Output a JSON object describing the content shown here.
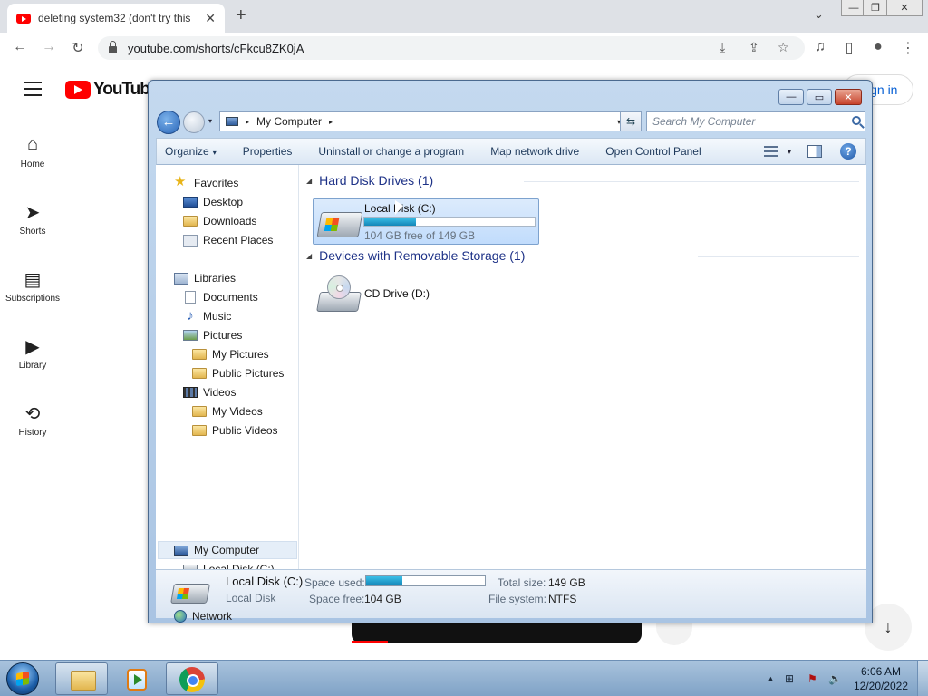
{
  "browser": {
    "tab_title": "deleting system32 (don't try this",
    "tab_close": "✕",
    "new_tab": "+",
    "tab_search": "⌄",
    "window_controls": [
      "—",
      "❐",
      "✕"
    ],
    "url": "youtube.com/shorts/cFkcu8ZK0jA",
    "nav_icons": {
      "back": "←",
      "forward": "→",
      "reload": "↻"
    },
    "omnibox_icons": {
      "install": "⤓",
      "share": "⇪",
      "bookmark": "☆"
    },
    "toolbar_icons": {
      "media": "♫",
      "sidepanel": "▯",
      "profile": "●",
      "menu": "⋮"
    }
  },
  "youtube": {
    "logo_text": "YouTube",
    "signin_label": "ign in",
    "nav": [
      {
        "icon": "⌂",
        "label": "Home"
      },
      {
        "icon": "➤",
        "label": "Shorts"
      },
      {
        "icon": "▤",
        "label": "Subscriptions"
      },
      {
        "icon": "▶",
        "label": "Library"
      },
      {
        "icon": "⟲",
        "label": "History"
      }
    ],
    "scroll_down_icon": "↓"
  },
  "explorer": {
    "window_buttons": {
      "minimize": "—",
      "maximize": "▭",
      "close": "✕"
    },
    "back_icon": "←",
    "address": {
      "path": "My Computer",
      "arrow": "▸",
      "dropdown": "▾"
    },
    "refresh_icon": "⇆",
    "search_placeholder": "Search My Computer",
    "commands": [
      {
        "label": "Organize",
        "dropdown": "▾"
      },
      {
        "label": "Properties"
      },
      {
        "label": "Uninstall or change a program"
      },
      {
        "label": "Map network drive"
      },
      {
        "label": "Open Control Panel"
      }
    ],
    "view_dropdown": "▾",
    "help_label": "?",
    "nav_items": [
      {
        "label": "Favorites",
        "icon": "star-icon",
        "glyph": "★"
      },
      {
        "label": "Desktop",
        "icon": "desktop-icon"
      },
      {
        "label": "Downloads",
        "icon": "folder-icon"
      },
      {
        "label": "Recent Places",
        "icon": "recent-places-icon"
      },
      {
        "label": "Libraries",
        "icon": "libraries-icon"
      },
      {
        "label": "Documents",
        "icon": "document-icon"
      },
      {
        "label": "Music",
        "icon": "music-icon",
        "glyph": "♪"
      },
      {
        "label": "Pictures",
        "icon": "pictures-icon"
      },
      {
        "label": "My Pictures",
        "icon": "folder-icon"
      },
      {
        "label": "Public Pictures",
        "icon": "folder-icon"
      },
      {
        "label": "Videos",
        "icon": "videos-icon"
      },
      {
        "label": "My Videos",
        "icon": "folder-icon"
      },
      {
        "label": "Public Videos",
        "icon": "folder-icon"
      },
      {
        "label": "My Computer",
        "icon": "computer-icon",
        "selected": true
      },
      {
        "label": "Local Disk (C:)",
        "icon": "disk-icon"
      },
      {
        "label": "Network",
        "icon": "network-icon"
      }
    ],
    "groups": {
      "hard_disks": {
        "toggle": "◢",
        "title": "Hard Disk Drives (1)"
      },
      "removable": {
        "toggle": "◢",
        "title": "Devices with Removable Storage (1)"
      }
    },
    "local_disk": {
      "name": "Local Disk (C:)",
      "free_text": "104 GB free of 149 GB",
      "used_fraction": 0.302
    },
    "cd_drive": {
      "name": "CD Drive (D:)"
    },
    "details": {
      "name": "Local Disk (C:)",
      "type": "Local Disk",
      "space_used_label": "Space used:",
      "space_free_label": "Space free:",
      "space_free_value": "104 GB",
      "total_size_label": "Total size:",
      "total_size_value": "149 GB",
      "file_system_label": "File system:",
      "file_system_value": "NTFS",
      "used_fraction": 0.302
    }
  },
  "taskbar": {
    "tray_icons": {
      "show_hidden": "▲",
      "network": "⊞",
      "flag": "⚑",
      "volume": "🔈"
    },
    "time": "6:06 AM",
    "date": "12/20/2022"
  },
  "colors": {
    "youtube_red": "#ff0000",
    "explorer_frame": "#a9c4e3",
    "link_blue": "#065fd4",
    "progress_cyan": "#1486b8"
  }
}
